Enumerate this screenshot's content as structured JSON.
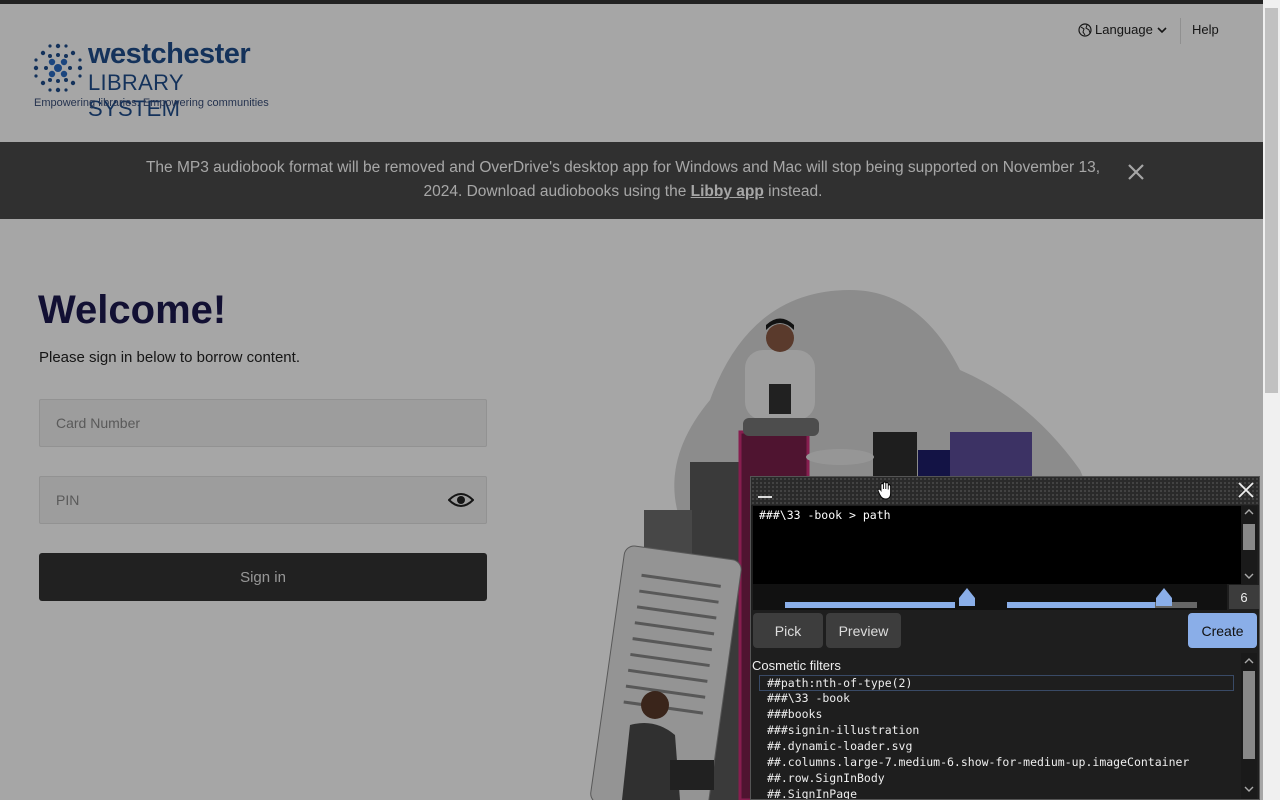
{
  "header": {
    "logo_word": "westchester",
    "logo_sub": "LIBRARY SYSTEM",
    "tagline": "Empowering libraries. Empowering communities",
    "language_label": "Language",
    "help_label": "Help"
  },
  "banner": {
    "text_before": "The MP3 audiobook format will be removed and OverDrive's desktop app for Windows and Mac will stop being supported on November 13, 2024. Download audiobooks using the ",
    "link": "Libby app",
    "text_after": " instead."
  },
  "signin": {
    "title": "Welcome!",
    "subtitle": "Please sign in below to borrow content.",
    "card_placeholder": "Card Number",
    "pin_placeholder": "PIN",
    "button": "Sign in"
  },
  "picker": {
    "selector": "###\\33 -book > path",
    "count": "6",
    "pick_label": "Pick",
    "preview_label": "Preview",
    "create_label": "Create",
    "cosmetic_title": "Cosmetic filters",
    "filters": [
      "##path:nth-of-type(2)",
      "###\\33 -book",
      "###books",
      "###signin-illustration",
      "##.dynamic-loader.svg",
      "##.columns.large-7.medium-6.show-for-medium-up.imageContainer",
      "##.row.SignInBody",
      "##.SignInPage"
    ]
  },
  "colors": {
    "brand": "#1f4e8c",
    "title": "#1d1a4f",
    "banner_bg": "#4a4a4a",
    "accent": "#8aaee8"
  }
}
